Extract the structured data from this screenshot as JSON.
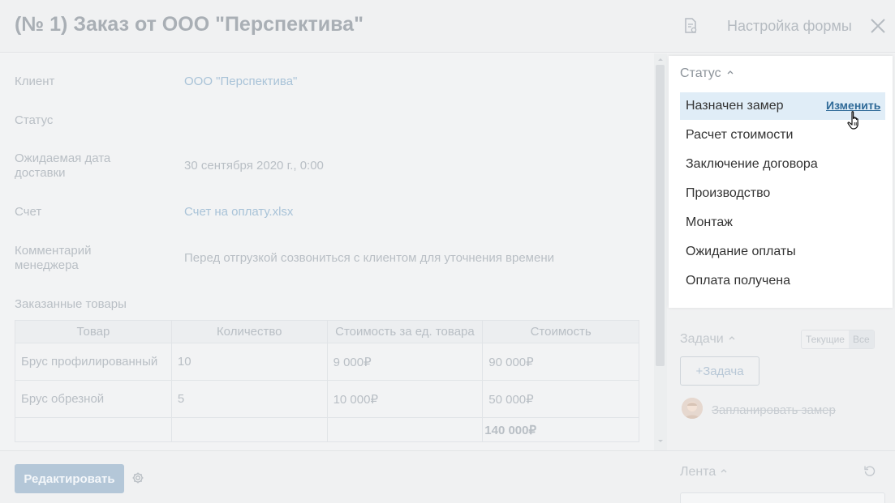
{
  "header": {
    "title": "(№ 1) Заказ от ООО \"Перспектива\"",
    "form_settings": "Настройка формы"
  },
  "fields": [
    {
      "label": "Клиент",
      "value": "ООО \"Перспектива\""
    },
    {
      "label": "Статус",
      "value": ""
    },
    {
      "label": "Ожидаемая дата доставки",
      "value": "30 сентября 2020 г., 0:00"
    },
    {
      "label": "Счет",
      "value": "Счет на оплату.xlsx"
    },
    {
      "label": "Комментарий менеджера",
      "value": "Перед отгрузкой созвониться с клиентом для уточнения времени"
    }
  ],
  "goods": {
    "title": "Заказанные товары",
    "columns": [
      "Товар",
      "Количество",
      "Стоимость за ед. товара",
      "Стоимость"
    ],
    "rows": [
      [
        "Брус профилированный",
        "10",
        "9 000₽",
        "90 000₽"
      ],
      [
        "Брус обрезной",
        "5",
        "10 000₽",
        "50 000₽"
      ]
    ],
    "total": "140 000₽"
  },
  "footer": {
    "edit_label": "Редактировать"
  },
  "status": {
    "title": "Статус",
    "change_label": "Изменить",
    "items": [
      "Назначен замер",
      "Расчет стоимости",
      "Заключение договора",
      "Производство",
      "Монтаж",
      "Ожидание оплаты",
      "Оплата получена"
    ]
  },
  "tasks": {
    "title": "Задачи",
    "filter_current": "Текущие",
    "filter_all": "Все",
    "add_label": "+Задача",
    "item": "Запланировать замер"
  },
  "feed": {
    "title": "Лента"
  },
  "colors": {
    "accent": "#2f6a98",
    "active_row": "#e0edf7"
  }
}
